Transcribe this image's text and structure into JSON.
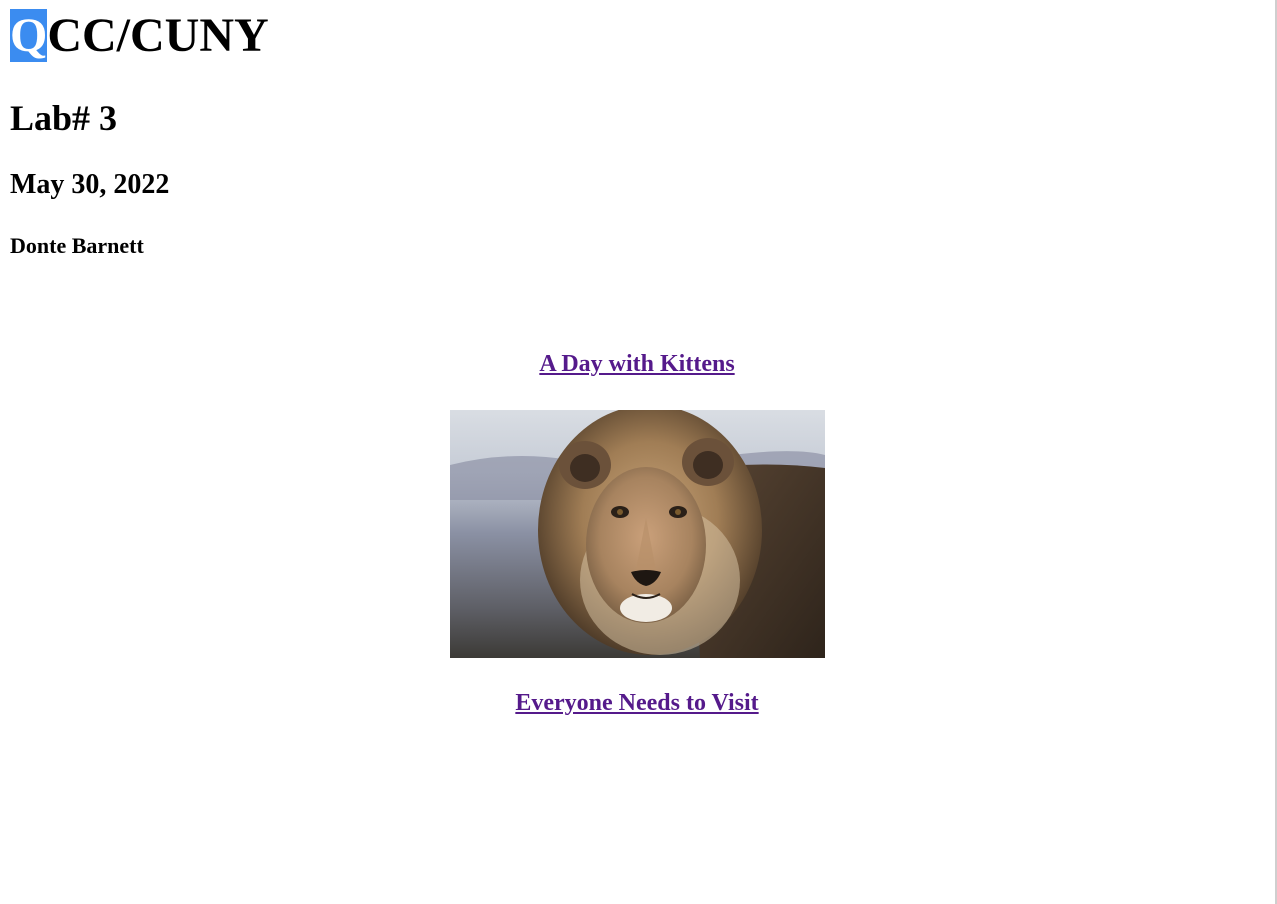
{
  "header": {
    "title_highlight": "Q",
    "title_rest": "CC/CUNY",
    "lab": "Lab# 3",
    "date": "May 30, 2022",
    "author": "Donte Barnett"
  },
  "links": {
    "kittens": "A Day with Kittens",
    "visit": "Everyone Needs to Visit"
  },
  "colors": {
    "visited_link": "#551a8b",
    "selection": "#3b8cf0"
  },
  "image": {
    "subject": "lion-photo"
  }
}
